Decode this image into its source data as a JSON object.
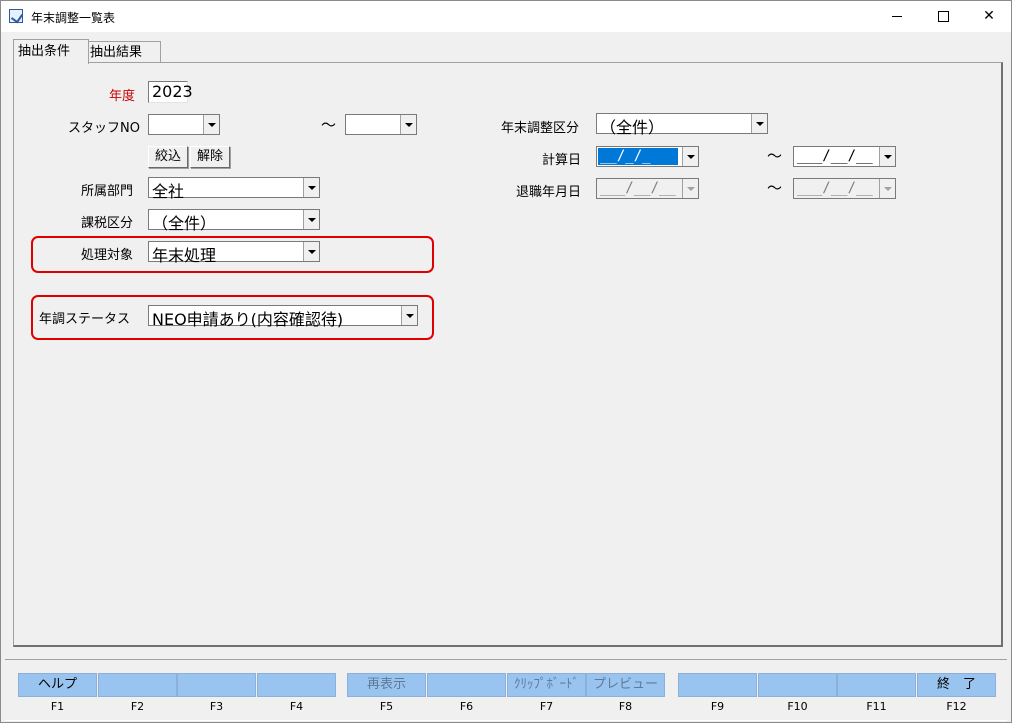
{
  "window": {
    "title": "年末調整一覧表",
    "icon": "app-icon",
    "controls": {
      "minimize": "minimize-icon",
      "maximize": "maximize-icon",
      "close": "✕"
    }
  },
  "tabs": [
    {
      "label": "抽出条件",
      "active": true
    },
    {
      "label": "抽出結果",
      "active": false
    }
  ],
  "form": {
    "nendo": {
      "label": "年度",
      "value": "2023",
      "label_color": "#cc0000"
    },
    "staff_no": {
      "label": "スタッフNO",
      "from": "",
      "to": "",
      "separator": "～"
    },
    "buttons": {
      "filter": "絞込",
      "clear": "解除"
    },
    "department": {
      "label": "所属部門",
      "value": "全社"
    },
    "tax_class": {
      "label": "課税区分",
      "value": "（全件）"
    },
    "process_target": {
      "label": "処理対象",
      "value": "年末処理"
    },
    "adjust_status": {
      "label": "年調ステータス",
      "value": "NEO申請あり(内容確認待)"
    },
    "year_end_class": {
      "label": "年末調整区分",
      "value": "（全件）"
    },
    "calc_date": {
      "label": "計算日",
      "from": "__/_/_",
      "to": "___/__/__",
      "separator": "～"
    },
    "retire_date": {
      "label": "退職年月日",
      "from": "___/__/__",
      "to": "___/__/__",
      "separator": "～"
    }
  },
  "highlight_color": "#e00000",
  "fkeys": [
    {
      "key": "F1",
      "label": "ヘルプ",
      "enabled": true
    },
    {
      "key": "F2",
      "label": "",
      "enabled": true
    },
    {
      "key": "F3",
      "label": "",
      "enabled": true
    },
    {
      "key": "F4",
      "label": "",
      "enabled": true
    },
    {
      "key": "F5",
      "label": "再表示",
      "enabled": false
    },
    {
      "key": "F6",
      "label": "",
      "enabled": true
    },
    {
      "key": "F7",
      "label": "ｸﾘｯﾌﾟﾎﾞｰﾄﾞ",
      "enabled": false
    },
    {
      "key": "F8",
      "label": "プレビュー",
      "enabled": false
    },
    {
      "key": "F9",
      "label": "",
      "enabled": true
    },
    {
      "key": "F10",
      "label": "",
      "enabled": true
    },
    {
      "key": "F11",
      "label": "",
      "enabled": true
    },
    {
      "key": "F12",
      "label": "終　了",
      "enabled": true
    }
  ]
}
